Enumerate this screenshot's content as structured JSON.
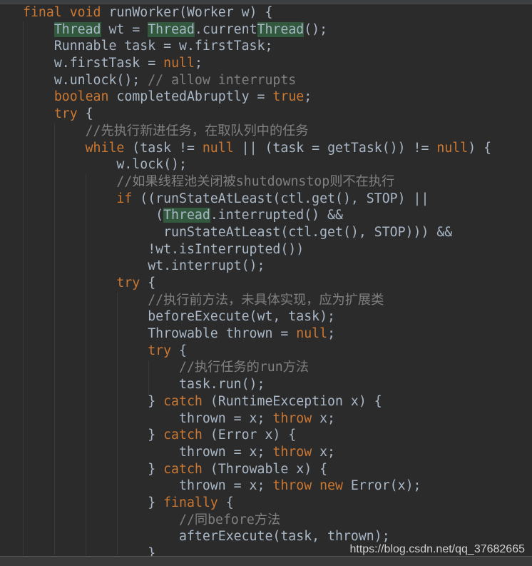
{
  "colors": {
    "background": "#2b2b2b",
    "keyword": "#cc7832",
    "text": "#a9b7c6",
    "comment": "#808080",
    "highlight": "#32593d"
  },
  "watermark": "https://blog.csdn.net/qq_37682665",
  "lines": [
    {
      "indent": 0,
      "segs": [
        [
          "kw",
          "final"
        ],
        [
          "p",
          " "
        ],
        [
          "kw",
          "void"
        ],
        [
          "p",
          " runWorker(Worker w) {"
        ]
      ]
    },
    {
      "indent": 4,
      "segs": [
        [
          "hl",
          "Thread"
        ],
        [
          "p",
          " wt = "
        ],
        [
          "hl",
          "Thread"
        ],
        [
          "p",
          ".current"
        ],
        [
          "hl",
          "Thread"
        ],
        [
          "p",
          "();"
        ]
      ]
    },
    {
      "indent": 4,
      "segs": [
        [
          "p",
          "Runnable task = w.firstTask;"
        ]
      ]
    },
    {
      "indent": 4,
      "segs": [
        [
          "p",
          "w.firstTask = "
        ],
        [
          "kw",
          "null"
        ],
        [
          "p",
          ";"
        ]
      ]
    },
    {
      "indent": 4,
      "segs": [
        [
          "p",
          "w.unlock();"
        ],
        [
          "cm",
          " // allow interrupts"
        ]
      ]
    },
    {
      "indent": 4,
      "segs": [
        [
          "kw",
          "boolean"
        ],
        [
          "p",
          " completedAbruptly = "
        ],
        [
          "kw",
          "true"
        ],
        [
          "p",
          ";"
        ]
      ]
    },
    {
      "indent": 4,
      "segs": [
        [
          "kw",
          "try"
        ],
        [
          "p",
          " {"
        ]
      ]
    },
    {
      "indent": 8,
      "segs": [
        [
          "cm",
          "//先执行新进任务，在取队列中的任务"
        ]
      ]
    },
    {
      "indent": 8,
      "segs": [
        [
          "kw",
          "while"
        ],
        [
          "p",
          " (task != "
        ],
        [
          "kw",
          "null"
        ],
        [
          "p",
          " || (task = getTask()) != "
        ],
        [
          "kw",
          "null"
        ],
        [
          "p",
          ") {"
        ]
      ]
    },
    {
      "indent": 12,
      "segs": [
        [
          "p",
          "w.lock();"
        ]
      ]
    },
    {
      "indent": 12,
      "segs": [
        [
          "cm",
          "//如果线程池关闭被shutdownstop则不在执行"
        ]
      ]
    },
    {
      "indent": 12,
      "segs": [
        [
          "kw",
          "if"
        ],
        [
          "p",
          " ((runStateAtLeast(ctl.get(), STOP) ||"
        ]
      ]
    },
    {
      "indent": 17,
      "segs": [
        [
          "p",
          "("
        ],
        [
          "hl",
          "Thread"
        ],
        [
          "p",
          ".interrupted() &&"
        ]
      ]
    },
    {
      "indent": 18,
      "segs": [
        [
          "p",
          "runStateAtLeast(ctl.get(), STOP))) &&"
        ]
      ]
    },
    {
      "indent": 16,
      "segs": [
        [
          "p",
          "!wt.isInterrupted())"
        ]
      ]
    },
    {
      "indent": 16,
      "segs": [
        [
          "p",
          "wt.interrupt();"
        ]
      ]
    },
    {
      "indent": 12,
      "segs": [
        [
          "kw",
          "try"
        ],
        [
          "p",
          " {"
        ]
      ]
    },
    {
      "indent": 16,
      "segs": [
        [
          "cm",
          "//执行前方法，未具体实现，应为扩展类"
        ]
      ]
    },
    {
      "indent": 16,
      "segs": [
        [
          "p",
          "beforeExecute(wt, task);"
        ]
      ]
    },
    {
      "indent": 16,
      "segs": [
        [
          "p",
          "Throwable thrown = "
        ],
        [
          "kw",
          "null"
        ],
        [
          "p",
          ";"
        ]
      ]
    },
    {
      "indent": 16,
      "segs": [
        [
          "kw",
          "try"
        ],
        [
          "p",
          " {"
        ]
      ]
    },
    {
      "indent": 20,
      "segs": [
        [
          "cm",
          "//执行任务的run方法"
        ]
      ]
    },
    {
      "indent": 20,
      "segs": [
        [
          "p",
          "task.run();"
        ]
      ]
    },
    {
      "indent": 16,
      "segs": [
        [
          "p",
          "} "
        ],
        [
          "kw",
          "catch"
        ],
        [
          "p",
          " (RuntimeException x) {"
        ]
      ]
    },
    {
      "indent": 20,
      "segs": [
        [
          "p",
          "thrown = x; "
        ],
        [
          "kw",
          "throw"
        ],
        [
          "p",
          " x;"
        ]
      ]
    },
    {
      "indent": 16,
      "segs": [
        [
          "p",
          "} "
        ],
        [
          "kw",
          "catch"
        ],
        [
          "p",
          " (Error x) {"
        ]
      ]
    },
    {
      "indent": 20,
      "segs": [
        [
          "p",
          "thrown = x; "
        ],
        [
          "kw",
          "throw"
        ],
        [
          "p",
          " x;"
        ]
      ]
    },
    {
      "indent": 16,
      "segs": [
        [
          "p",
          "} "
        ],
        [
          "kw",
          "catch"
        ],
        [
          "p",
          " (Throwable x) {"
        ]
      ]
    },
    {
      "indent": 20,
      "segs": [
        [
          "p",
          "thrown = x; "
        ],
        [
          "kw",
          "throw"
        ],
        [
          "p",
          " "
        ],
        [
          "kw",
          "new"
        ],
        [
          "p",
          " Error(x);"
        ]
      ]
    },
    {
      "indent": 16,
      "segs": [
        [
          "p",
          "} "
        ],
        [
          "kw",
          "finally"
        ],
        [
          "p",
          " {"
        ]
      ]
    },
    {
      "indent": 20,
      "segs": [
        [
          "cm",
          "//同before方法"
        ]
      ]
    },
    {
      "indent": 20,
      "segs": [
        [
          "p",
          "afterExecute(task, thrown);"
        ]
      ]
    },
    {
      "indent": 16,
      "segs": [
        [
          "p",
          "}"
        ]
      ]
    }
  ]
}
